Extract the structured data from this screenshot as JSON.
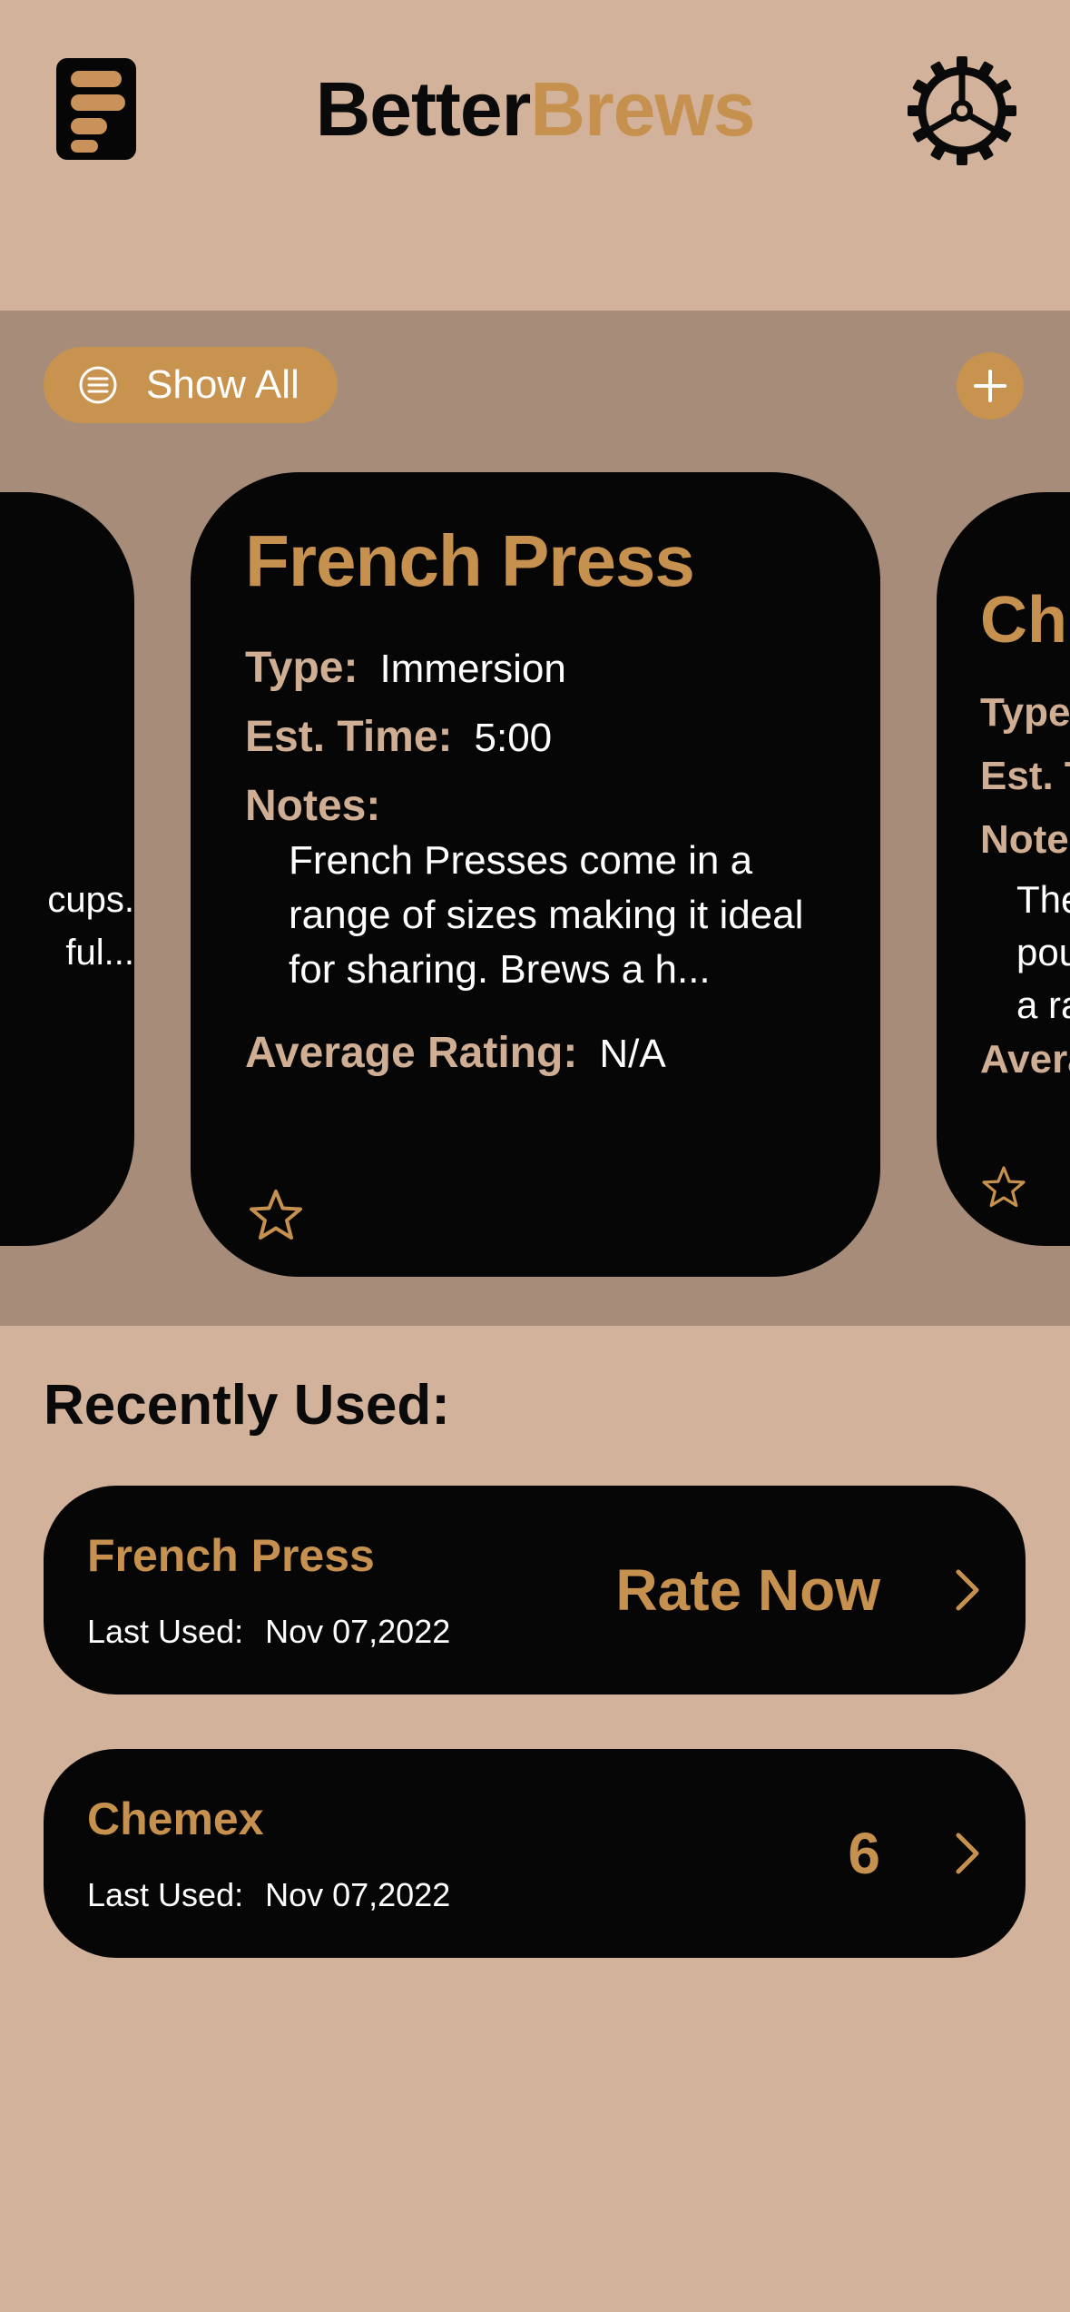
{
  "app": {
    "title_part1": "Better",
    "title_part2": "Brews",
    "icons": {
      "menu": "menu-lines-icon",
      "settings": "gear-icon"
    }
  },
  "carousel": {
    "show_all_label": "Show All",
    "add_icon": "plus-icon",
    "cards": {
      "left": {
        "notes_lines": [
          "cups.",
          "ful..."
        ]
      },
      "center": {
        "name": "French Press",
        "type_label": "Type:",
        "type_value": "Immersion",
        "time_label": "Est. Time:",
        "time_value": "5:00",
        "notes_label": "Notes:",
        "notes": "French Presses come in a range of sizes making it ideal for sharing. Brews a h...",
        "rating_label": "Average Rating:",
        "rating_value": "N/A",
        "favorite_icon": "star-outline-icon"
      },
      "right": {
        "name": "Ch",
        "type_label": "Type",
        "time_label": "Est. T",
        "notes_label": "Notes",
        "notes_lines": [
          "The",
          "pou",
          "a ra"
        ],
        "rating_label": "Avera"
      }
    }
  },
  "recent": {
    "title": "Recently Used:",
    "items": [
      {
        "name": "French Press",
        "last_used_label": "Last Used:",
        "date": "Nov 07,2022",
        "action": "Rate Now"
      },
      {
        "name": "Chemex",
        "last_used_label": "Last Used:",
        "date": "Nov 07,2022",
        "action": "6"
      }
    ]
  },
  "colors": {
    "background": "#d2b29a",
    "accent": "#c6904e",
    "card": "#060606",
    "carousel_bg": "#a68c79"
  }
}
